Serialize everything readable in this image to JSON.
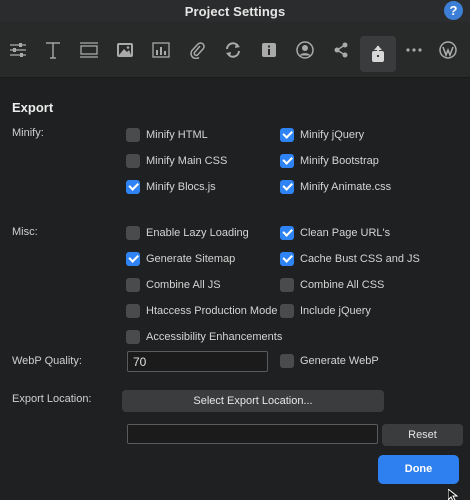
{
  "window": {
    "title": "Project Settings",
    "help_label": "?"
  },
  "toolbar": {
    "icons": [
      "sliders-icon",
      "text-icon",
      "layout-icon",
      "image-icon",
      "chart-icon",
      "paperclip-icon",
      "sync-icon",
      "info-icon",
      "user-icon",
      "share-icon",
      "export-icon",
      "more-icon",
      "wordpress-icon"
    ],
    "active": "export-icon"
  },
  "export": {
    "heading": "Export",
    "minify_label": "Minify:",
    "misc_label": "Misc:",
    "webp_label": "WebP Quality:",
    "location_label": "Export Location:",
    "minify_options": [
      {
        "label": "Minify HTML",
        "checked": false
      },
      {
        "label": "Minify jQuery",
        "checked": true
      },
      {
        "label": "Minify Main CSS",
        "checked": false
      },
      {
        "label": "Minify Bootstrap",
        "checked": true
      },
      {
        "label": "Minify Blocs.js",
        "checked": true
      },
      {
        "label": "Minify Animate.css",
        "checked": true
      }
    ],
    "misc_options": [
      {
        "label": "Enable Lazy Loading",
        "checked": false
      },
      {
        "label": "Clean Page URL's",
        "checked": true
      },
      {
        "label": "Generate Sitemap",
        "checked": true
      },
      {
        "label": "Cache Bust CSS and JS",
        "checked": true
      },
      {
        "label": "Combine All JS",
        "checked": false
      },
      {
        "label": "Combine All CSS",
        "checked": false
      },
      {
        "label": "Htaccess Production Mode",
        "checked": false
      },
      {
        "label": "Include jQuery",
        "checked": false
      },
      {
        "label": "Accessibility Enhancements",
        "checked": false
      }
    ],
    "webp_quality": "70",
    "generate_webp": {
      "label": "Generate WebP",
      "checked": false
    },
    "select_location_label": "Select Export Location...",
    "location_value": "",
    "reset_label": "Reset",
    "done_label": "Done"
  },
  "colors": {
    "accent": "#2f84f5",
    "panel": "#1f2021",
    "toolbar": "#282929"
  }
}
